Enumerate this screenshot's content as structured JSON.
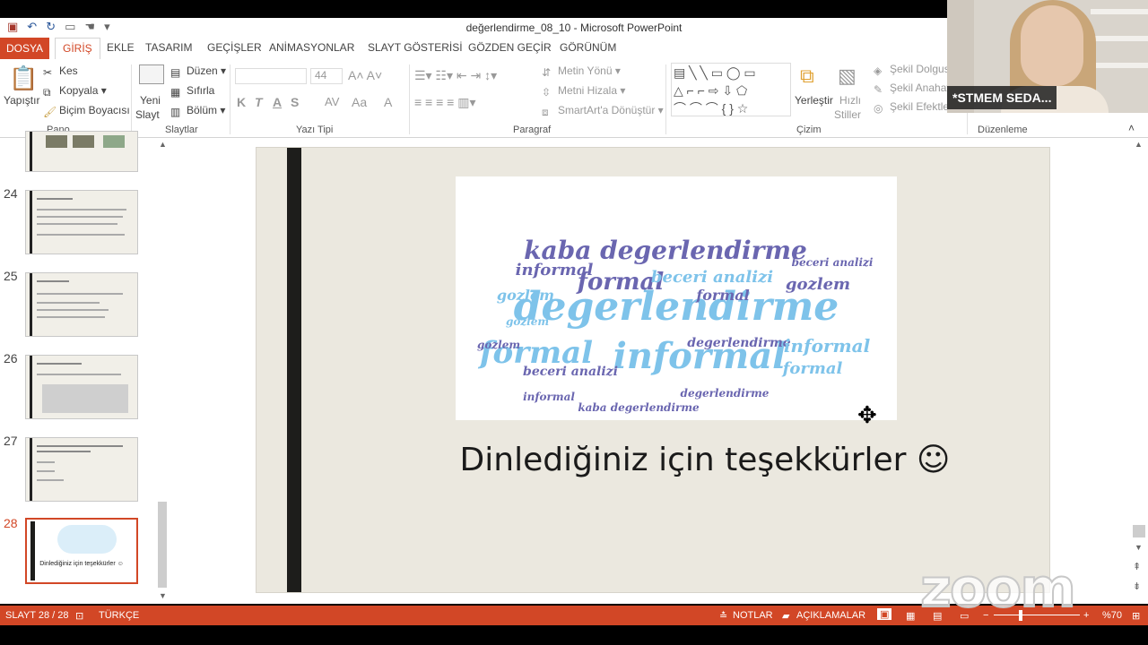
{
  "window": {
    "title": "değerlendirme_08_10 - Microsoft PowerPoint"
  },
  "tabs": [
    "DOSYA",
    "GİRİŞ",
    "EKLE",
    "TASARIM",
    "GEÇİŞLER",
    "ANİMASYONLAR",
    "SLAYT GÖSTERİSİ",
    "GÖZDEN GEÇİR",
    "GÖRÜNÜM"
  ],
  "ribbon": {
    "pano": {
      "label": "Pano",
      "paste": "Yapıştır",
      "cut": "Kes",
      "copy": "Kopyala",
      "format_painter": "Biçim Boyacısı"
    },
    "slaytlar": {
      "label": "Slaytlar",
      "new_slide_line1": "Yeni",
      "new_slide_line2": "Slayt",
      "layout": "Düzen",
      "reset": "Sıfırla",
      "section": "Bölüm"
    },
    "yazi_tipi": {
      "label": "Yazı Tipi",
      "font_size": "44",
      "bold": "K",
      "italic": "T",
      "underline": "A",
      "strike": "S",
      "spacing": "AV",
      "case": "Aa",
      "color": "A"
    },
    "paragraf": {
      "label": "Paragraf",
      "text_direction": "Metin Yönü",
      "align_text": "Metni Hizala",
      "smartart": "SmartArt'a Dönüştür"
    },
    "cizim": {
      "label": "Çizim",
      "arrange": "Yerleştir",
      "quick_styles_line1": "Hızlı",
      "quick_styles_line2": "Stiller",
      "shape_fill": "Şekil Dolgusu",
      "shape_outline": "Şekil Anahat",
      "shape_effects": "Şekil Efektler"
    },
    "duzenleme": {
      "label": "Düzenleme"
    }
  },
  "slides": [
    {
      "num": "24"
    },
    {
      "num": "25"
    },
    {
      "num": "26"
    },
    {
      "num": "27"
    },
    {
      "num": "28",
      "caption": "Dinlediğiniz için teşekkürler ☺"
    }
  ],
  "current_slide": {
    "caption": "Dinlediğiniz için teşekkürler ☺",
    "wordcloud": [
      {
        "text": "degerlendirme",
        "size": 44,
        "color": "#7ec3ea"
      },
      {
        "text": "kaba degerlendirme",
        "size": 28,
        "color": "#6a66b0"
      },
      {
        "text": "informal",
        "size": 40,
        "color": "#7ec3ea"
      },
      {
        "text": "formal",
        "size": 34,
        "color": "#7ec3ea"
      },
      {
        "text": "formal",
        "size": 26,
        "color": "#6a66b0"
      },
      {
        "text": "gozlem",
        "size": 18,
        "color": "#6a66b0"
      },
      {
        "text": "beceri analizi",
        "size": 18,
        "color": "#7ec3ea"
      },
      {
        "text": "informal",
        "size": 18,
        "color": "#6a66b0"
      },
      {
        "text": "gozlem",
        "size": 16,
        "color": "#7ec3ea"
      },
      {
        "text": "beceri analizi",
        "size": 14,
        "color": "#6a66b0"
      },
      {
        "text": "formal",
        "size": 16,
        "color": "#6a66b0"
      },
      {
        "text": "degerlendirme",
        "size": 14,
        "color": "#6a66b0"
      },
      {
        "text": "informal",
        "size": 20,
        "color": "#7ec3ea"
      },
      {
        "text": "gozlem",
        "size": 12,
        "color": "#6a66b0"
      },
      {
        "text": "formal",
        "size": 18,
        "color": "#7ec3ea"
      },
      {
        "text": "degerlendirme",
        "size": 12,
        "color": "#6a66b0"
      },
      {
        "text": "kaba degerlendirme",
        "size": 12,
        "color": "#6a66b0"
      },
      {
        "text": "informal",
        "size": 12,
        "color": "#6a66b0"
      },
      {
        "text": "gozlem",
        "size": 12,
        "color": "#7ec3ea"
      },
      {
        "text": "beceri analizi",
        "size": 12,
        "color": "#6a66b0"
      }
    ]
  },
  "status_bar": {
    "slide_info": "SLAYT 28 / 28",
    "language": "TÜRKÇE",
    "notes": "NOTLAR",
    "comments": "AÇIKLAMALAR",
    "zoom": "%70"
  },
  "video": {
    "participant_name": "*STMEM SEDA..."
  },
  "watermark": "zoom",
  "colors": {
    "accent": "#d24726",
    "wc_light": "#7ec3ea",
    "wc_dark": "#6a66b0"
  }
}
